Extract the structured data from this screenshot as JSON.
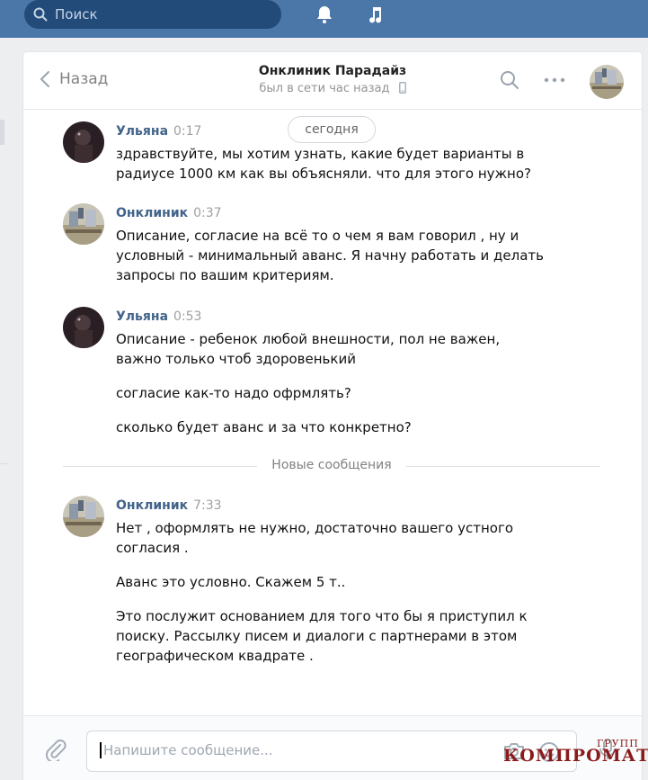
{
  "topbar": {
    "search_placeholder": "Поиск",
    "icons": [
      "search-icon",
      "bell-icon",
      "music-icon"
    ]
  },
  "header": {
    "back_label": "Назад",
    "title": "Онклиник Парадайз",
    "status": "был в сети час назад"
  },
  "date_pill": "сегодня",
  "messages": [
    {
      "author": "Ульяна",
      "time": "0:17",
      "paragraphs": [
        "здравствуйте, мы хотим узнать, какие будет варианты в радиусе 1000 км как вы объясняли. что для этого нужно?"
      ]
    },
    {
      "author": "Онклиник",
      "time": "0:37",
      "paragraphs": [
        "Описание, согласие на всё то о чем я вам говорил , ну и условный - минимальный аванс. Я начну работать и делать запросы по вашим критериям."
      ]
    },
    {
      "author": "Ульяна",
      "time": "0:53",
      "paragraphs": [
        "Описание - ребенок любой внешности, пол не важен, важно только чтоб здоровенький",
        "согласие как-то надо офрмлять?",
        "сколько будет аванс и за что конкретно?"
      ]
    },
    {
      "author": "Онклиник",
      "time": "7:33",
      "paragraphs": [
        "Нет , оформлять не нужно, достаточно вашего устного согласия .",
        "Аванс это условно. Скажем 5 т..",
        "Это послужит основанием для того что бы я приступил к поиску. Рассылку писем и диалоги с партнерами в этом географическом квадрате ."
      ]
    }
  ],
  "divider_label": "Новые сообщения",
  "composer": {
    "placeholder": "Напишите сообщение..."
  },
  "watermark": {
    "main": "КОМПРОМАТ",
    "sub": "ГРУПП"
  },
  "colors": {
    "topbar": "#4a76a8",
    "search_bg": "#224b7a",
    "author": "#42648b"
  }
}
